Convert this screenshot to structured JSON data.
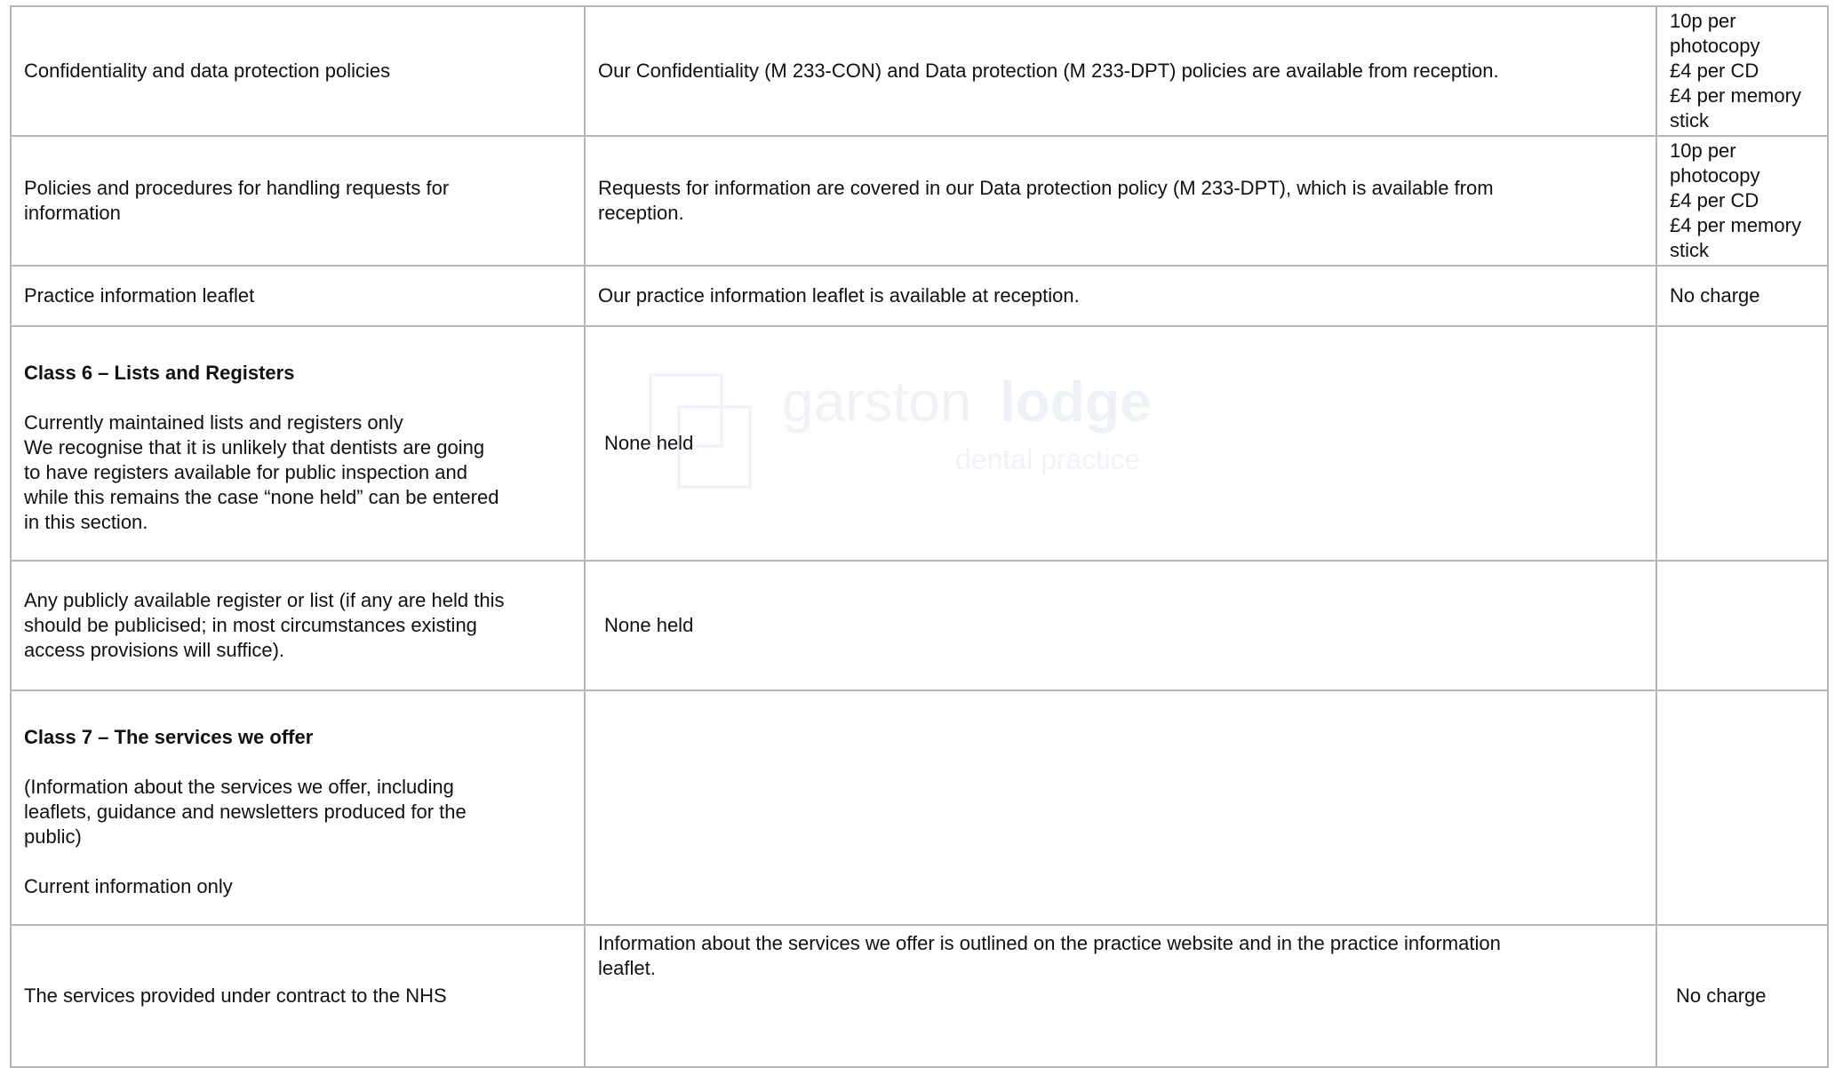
{
  "watermark": {
    "logo_word1": "garston",
    "logo_word2": "lodge",
    "logo_tagline": "dental practice"
  },
  "rows": [
    {
      "col1": "Confidentiality and data protection policies",
      "col2": "Our Confidentiality (M 233-CON) and Data protection (M 233-DPT) policies are available from reception.",
      "col3": "10p per\nphotocopy\n£4 per CD\n£4 per memory\nstick"
    },
    {
      "col1": "Policies and procedures for handling requests for\ninformation",
      "col2": "Requests for information are covered in our Data protection policy (M 233-DPT), which is available from\nreception.",
      "col3": "10p per\nphotocopy\n£4 per CD\n£4 per memory\nstick"
    },
    {
      "col1": "Practice information leaflet",
      "col2": "Our practice information leaflet is available at reception.",
      "col3": "No charge"
    },
    {
      "col1_heading": "Class 6 – Lists and Registers",
      "col1": "Currently maintained lists and registers only\nWe recognise that it is unlikely that dentists are going\nto have registers available for public inspection and\nwhile this remains the case “none held” can be entered\nin this section.",
      "col2": "None held",
      "col3": ""
    },
    {
      "col1": "Any publicly available register or list (if any are held this\nshould be publicised; in most circumstances existing\naccess provisions will suffice).",
      "col2": "None held",
      "col3": ""
    },
    {
      "col1_heading": "Class 7 – The services we offer",
      "col1": "(Information about the services we offer, including\nleaflets, guidance and newsletters produced for the\npublic)\n\nCurrent information only",
      "col2": "",
      "col3": ""
    },
    {
      "col1": "The services provided under contract to the NHS",
      "col2": " Information about the services we offer is outlined on the practice website and in the practice information\nleaflet.",
      "col3": "No charge"
    }
  ]
}
